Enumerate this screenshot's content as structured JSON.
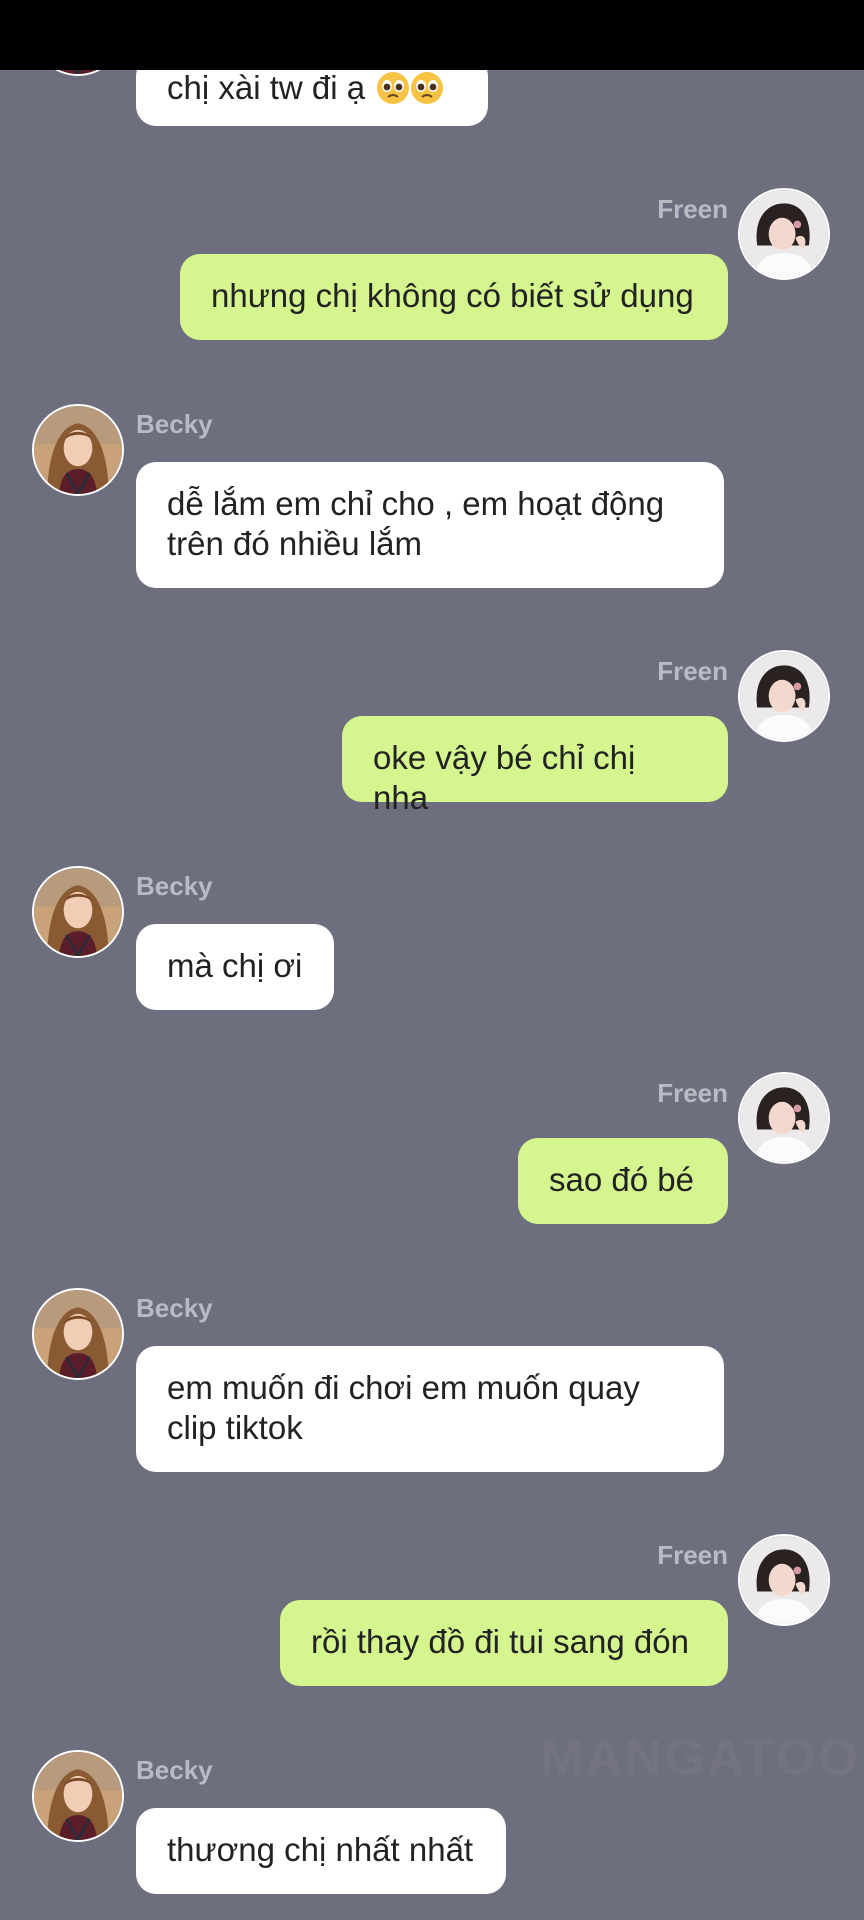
{
  "chat": {
    "participants": {
      "becky": {
        "name": "Becky"
      },
      "freen": {
        "name": "Freen"
      }
    },
    "messages": [
      {
        "sender": "becky",
        "text": "chị xài tw đi ạ",
        "emoji": [
          "pleading-face",
          "pleading-face"
        ]
      },
      {
        "sender": "freen",
        "name": "Freen",
        "text": "nhưng chị không có biết sử dụng"
      },
      {
        "sender": "becky",
        "name": "Becky",
        "line1": "dễ lắm em chỉ cho , em hoạt động",
        "line2": "trên đó nhiều lắm"
      },
      {
        "sender": "freen",
        "name": "Freen",
        "text": "oke vậy bé chỉ chị nha"
      },
      {
        "sender": "becky",
        "name": "Becky",
        "text": "mà chị ơi"
      },
      {
        "sender": "freen",
        "name": "Freen",
        "text": "sao đó bé"
      },
      {
        "sender": "becky",
        "name": "Becky",
        "line1": "em muốn đi chơi em muốn quay",
        "line2": "clip tiktok"
      },
      {
        "sender": "freen",
        "name": "Freen",
        "text": "rồi thay đồ đi tui sang đón"
      },
      {
        "sender": "becky",
        "name": "Becky",
        "text": "thương chị nhất nhất"
      }
    ]
  },
  "watermark": {
    "text": "MANGATOON"
  },
  "colors": {
    "background": "#6e6f7e",
    "incoming_bubble": "#ffffff",
    "outgoing_bubble": "#d5f58e",
    "name_label": "#b9bbc4",
    "status_bar": "#000000"
  }
}
